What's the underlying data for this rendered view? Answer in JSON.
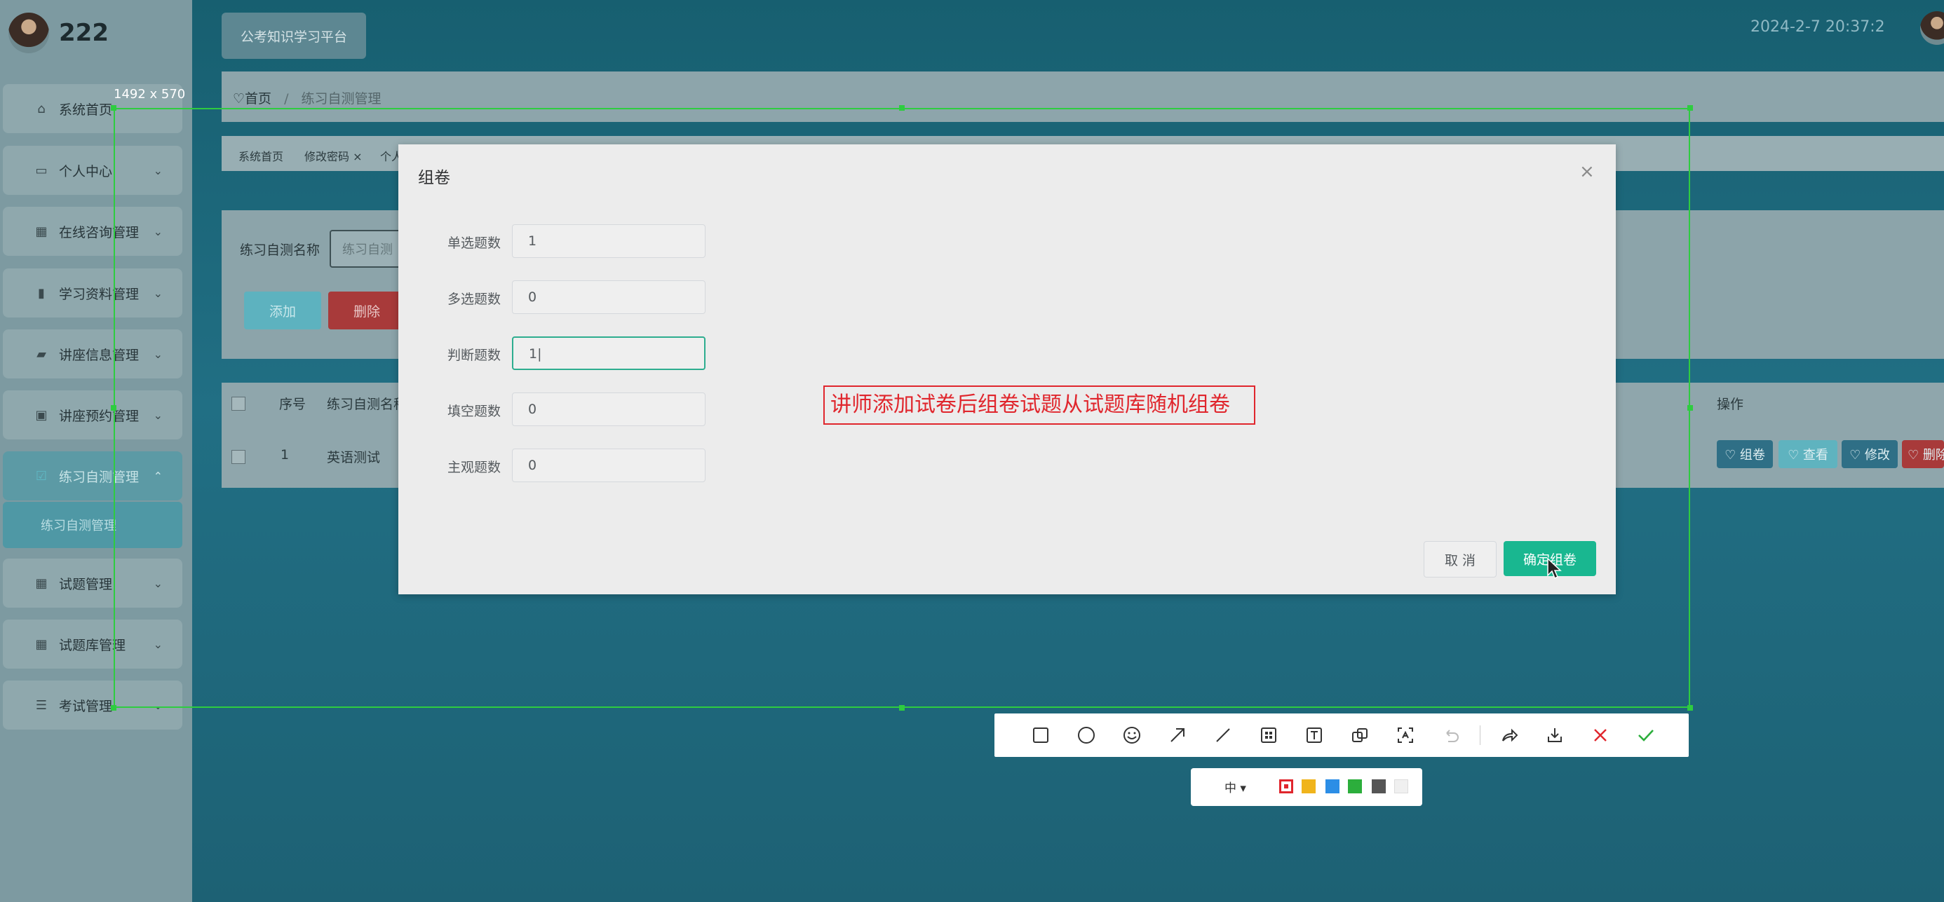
{
  "app": {
    "name": "222",
    "platform_button": "公考知识学习平台",
    "datetime": "2024-2-7 20:37:2"
  },
  "sidebar": {
    "items": [
      {
        "label": "系统首页",
        "icon": "home-icon",
        "glyph": "⌂",
        "has_chevron": false
      },
      {
        "label": "个人中心",
        "icon": "user-card-icon",
        "glyph": "▭",
        "has_chevron": true
      },
      {
        "label": "在线咨询管理",
        "icon": "grid-icon",
        "glyph": "▦",
        "has_chevron": true
      },
      {
        "label": "学习资料管理",
        "icon": "books-icon",
        "glyph": "▮",
        "has_chevron": true
      },
      {
        "label": "讲座信息管理",
        "icon": "briefcase-icon",
        "glyph": "▰",
        "has_chevron": true
      },
      {
        "label": "讲座预约管理",
        "icon": "clipboard-icon",
        "glyph": "▣",
        "has_chevron": true
      },
      {
        "label": "练习自测管理",
        "icon": "checkbox-icon",
        "glyph": "☑",
        "has_chevron": true,
        "active": true
      },
      {
        "label": "试题管理",
        "icon": "grid-icon",
        "glyph": "▦",
        "has_chevron": true
      },
      {
        "label": "试题库管理",
        "icon": "grid-icon",
        "glyph": "▦",
        "has_chevron": true
      },
      {
        "label": "考试管理",
        "icon": "sliders-icon",
        "glyph": "☰",
        "has_chevron": true
      }
    ],
    "submenu_active": "练习自测管理"
  },
  "breadcrumb": {
    "home": "♡首页",
    "separator": "/",
    "current": "练习自测管理"
  },
  "tabs": [
    "系统首页",
    "修改密码 ×",
    "个人"
  ],
  "search": {
    "label": "练习自测名称",
    "placeholder": "练习自测"
  },
  "actions": {
    "add": "添加",
    "delete": "删除"
  },
  "table": {
    "headers": [
      "序号",
      "练习自测名称",
      "操作"
    ],
    "rows": [
      {
        "index": "1",
        "name": "英语测试"
      }
    ],
    "row_actions": [
      "♡ 组卷",
      "♡ 查看",
      "♡ 修改",
      "♡ 删除"
    ]
  },
  "capture": {
    "size_label": "1492 x 570"
  },
  "dialog": {
    "title": "组卷",
    "close": "×",
    "fields": [
      {
        "label": "单选题数",
        "value": "1"
      },
      {
        "label": "多选题数",
        "value": "0"
      },
      {
        "label": "判断题数",
        "value": "1|",
        "focused": true
      },
      {
        "label": "填空题数",
        "value": "0"
      },
      {
        "label": "主观题数",
        "value": "0"
      }
    ],
    "cancel": "取 消",
    "confirm": "确定组卷"
  },
  "annotation": {
    "text": "讲师添加试卷后组卷试题从试题库随机组卷",
    "color": "#e0262d"
  },
  "toolbar": {
    "tools": [
      "rectangle-icon",
      "ellipse-icon",
      "emoji-icon",
      "arrow-icon",
      "line-icon",
      "mosaic-icon",
      "text-icon",
      "copy-icon",
      "ocr-icon",
      "undo-icon",
      "share-icon",
      "download-icon",
      "cancel-icon",
      "confirm-icon"
    ],
    "size": "中 ▾",
    "colors": [
      "#e0262d",
      "#f0b41c",
      "#2c8ee6",
      "#2cae3c",
      "#555555",
      "#f0f0f0"
    ]
  },
  "colors": {
    "accent": "#19b790",
    "selection": "#2ecc40"
  }
}
